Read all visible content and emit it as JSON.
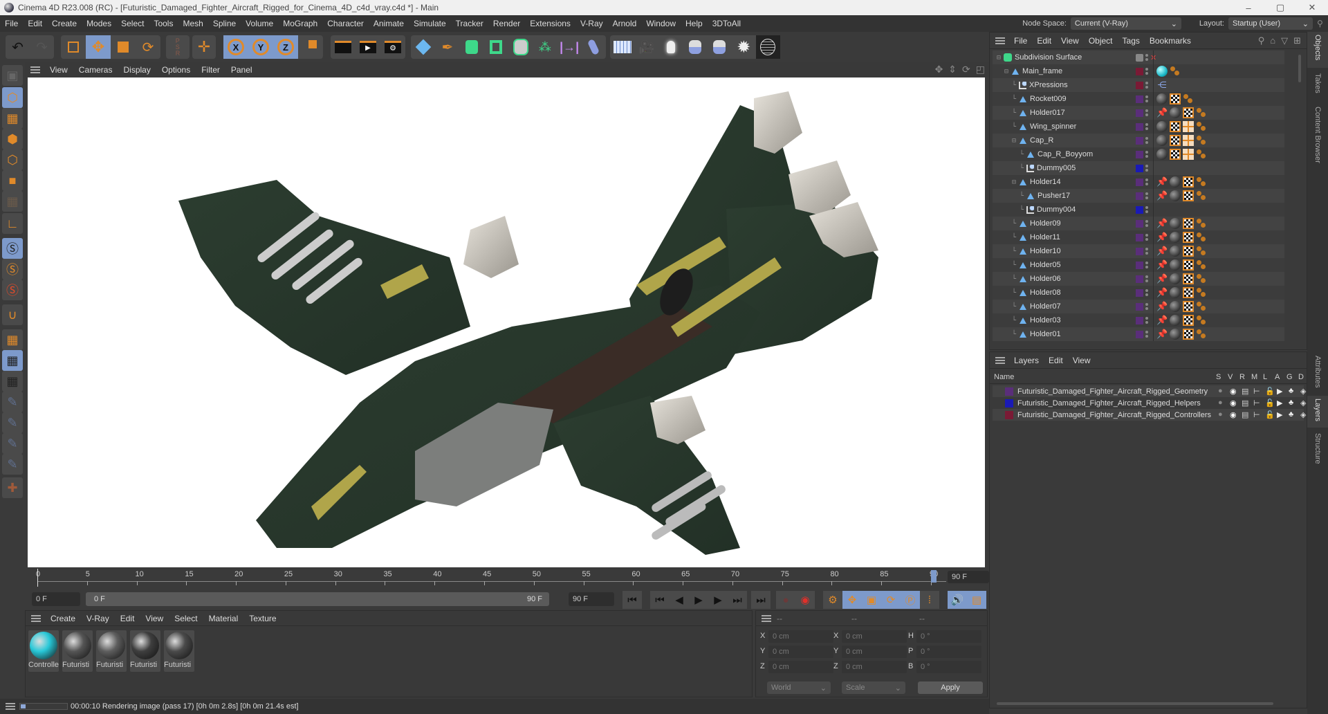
{
  "window": {
    "title": "Cinema 4D R23.008 (RC) - [Futuristic_Damaged_Fighter_Aircraft_Rigged_for_Cinema_4D_c4d_vray.c4d *] - Main",
    "controls": [
      "–",
      "▢",
      "✕"
    ]
  },
  "menubar": {
    "items": [
      "File",
      "Edit",
      "Create",
      "Modes",
      "Select",
      "Tools",
      "Mesh",
      "Spline",
      "Volume",
      "MoGraph",
      "Character",
      "Animate",
      "Simulate",
      "Tracker",
      "Render",
      "Extensions",
      "V-Ray",
      "Arnold",
      "Window",
      "Help",
      "3DToAll"
    ],
    "node_space_label": "Node Space:",
    "node_space_value": "Current (V-Ray)",
    "layout_label": "Layout:",
    "layout_value": "Startup (User)"
  },
  "toolbar": {
    "groups": [
      [
        "undo-icon",
        "redo-icon"
      ],
      [
        "live-selection-icon",
        "move-icon",
        "scale-icon",
        "rotate-icon"
      ],
      [
        "psr-icon"
      ],
      [
        "recent-tool-icon"
      ],
      [
        "x-axis-icon",
        "y-axis-icon",
        "z-axis-icon",
        "coordinate-system-icon"
      ],
      [
        "render-view-icon",
        "render-picture-viewer-icon",
        "render-settings-icon"
      ],
      [
        "cube-icon",
        "pen-icon",
        "subdivision-icon",
        "extrude-icon",
        "cloner-icon",
        "mograph-icon",
        "symmetry-icon",
        "bend-icon"
      ],
      [
        "floor-icon",
        "camera-icon",
        "light-icon",
        "python-icon",
        "python2-icon",
        "gear-shape-icon",
        "sphere-wire-icon"
      ]
    ],
    "active": [
      "move-icon",
      "x-axis-icon",
      "y-axis-icon",
      "z-axis-icon"
    ]
  },
  "lefttools": [
    "make-editable-icon",
    "model-mode-icon",
    "texture-mode-icon",
    "points-mode-icon",
    "edges-mode-icon",
    "polygons-mode-icon",
    "uv-mode-icon",
    "axis-mode-icon",
    "snap-icon",
    "snap-settings-icon",
    "snap-extra-icon",
    "magnet-icon",
    "workplane-icon",
    "locked-workplane-icon",
    "workplane-rotate-icon",
    "pin-icon",
    "pin-p-icon",
    "pin-r-icon",
    "pin-target-icon",
    "paint-icon"
  ],
  "viewport": {
    "menu": [
      "View",
      "Cameras",
      "Display",
      "Options",
      "Filter",
      "Panel"
    ],
    "nav_icons": [
      "move-view-icon",
      "zoom-view-icon",
      "rotate-view-icon",
      "maximize-view-icon"
    ]
  },
  "timeline": {
    "ticks": [
      "0",
      "5",
      "10",
      "15",
      "20",
      "25",
      "30",
      "35",
      "40",
      "45",
      "50",
      "55",
      "60",
      "65",
      "70",
      "75",
      "80",
      "85",
      "90"
    ],
    "current_frame": "0 F",
    "start_field": "0 F",
    "range_start": "0 F",
    "range_end": "90 F",
    "end_field": "90 F",
    "max_field": "90 F",
    "playhead_frame": 0
  },
  "playback": {
    "buttons": [
      "go-to-start-icon",
      "previous-key-icon",
      "previous-frame-icon",
      "play-icon",
      "next-frame-icon",
      "next-key-icon",
      "go-to-end-icon",
      "record-disabled-icon",
      "autokey-icon",
      "keyframe-selection-icon",
      "move-key-icon",
      "scale-key-icon",
      "rotate-key-icon",
      "param-key-icon",
      "pla-key-icon",
      "sound-icon",
      "timeline-icon"
    ]
  },
  "material_manager": {
    "menu": [
      "Create",
      "V-Ray",
      "Edit",
      "View",
      "Select",
      "Material",
      "Texture"
    ],
    "materials": [
      {
        "label": "Controlle",
        "color": "#28c8d8"
      },
      {
        "label": "Futuristi",
        "color": "#555555"
      },
      {
        "label": "Futuristi",
        "color": "#5e5e5e"
      },
      {
        "label": "Futuristi",
        "color": "#3e3e3e"
      },
      {
        "label": "Futuristi",
        "color": "#4a4a4a"
      }
    ]
  },
  "coordinates": {
    "headers": [
      "--",
      "--",
      "--"
    ],
    "rows": [
      {
        "l1": "X",
        "v1": "0 cm",
        "l2": "X",
        "v2": "0 cm",
        "l3": "H",
        "v3": "0 °"
      },
      {
        "l1": "Y",
        "v1": "0 cm",
        "l2": "Y",
        "v2": "0 cm",
        "l3": "P",
        "v3": "0 °"
      },
      {
        "l1": "Z",
        "v1": "0 cm",
        "l2": "Z",
        "v2": "0 cm",
        "l3": "B",
        "v3": "0 °"
      }
    ],
    "mode": "World",
    "transform": "Scale",
    "apply_label": "Apply"
  },
  "status": {
    "text": "00:00:10 Rendering image (pass 17) [0h  0m  2.8s] [0h  0m 21.4s est]",
    "progress": 0.1
  },
  "object_manager": {
    "menu": [
      "File",
      "Edit",
      "View",
      "Object",
      "Tags",
      "Bookmarks"
    ],
    "objects": [
      {
        "name": "Subdivision Surface",
        "depth": 0,
        "type": "subdiv",
        "layer": null,
        "tags": []
      },
      {
        "name": "Main_frame",
        "depth": 1,
        "type": "null",
        "layer": "#7a1a35",
        "tags": [
          "cyan-mat",
          "xp"
        ]
      },
      {
        "name": "XPressions",
        "depth": 2,
        "type": "dummy",
        "layer": "#7a1a35",
        "tags": [
          "xpresso"
        ]
      },
      {
        "name": "Rocket009",
        "depth": 2,
        "type": "null",
        "layer": "#5a2e7a",
        "tags": [
          "mat",
          "tex",
          "xp"
        ]
      },
      {
        "name": "Holder017",
        "depth": 2,
        "type": "null",
        "layer": "#5a2e7a",
        "tags": [
          "ik",
          "mat",
          "tex",
          "xp"
        ]
      },
      {
        "name": "Wing_spinner",
        "depth": 2,
        "type": "null",
        "layer": "#5a2e7a",
        "tags": [
          "mat",
          "tex",
          "uvw",
          "xp"
        ]
      },
      {
        "name": "Cap_R",
        "depth": 2,
        "type": "null",
        "layer": "#5a2e7a",
        "tags": [
          "mat",
          "tex",
          "uvw",
          "xp"
        ]
      },
      {
        "name": "Cap_R_Boyyom",
        "depth": 3,
        "type": "null",
        "layer": "#5a2e7a",
        "tags": [
          "mat",
          "tex",
          "uvw",
          "xp"
        ]
      },
      {
        "name": "Dummy005",
        "depth": 3,
        "type": "dummy",
        "layer": "#1a1ab5",
        "tags": []
      },
      {
        "name": "Holder14",
        "depth": 2,
        "type": "null",
        "layer": "#5a2e7a",
        "tags": [
          "ik",
          "mat",
          "tex",
          "xp"
        ]
      },
      {
        "name": "Pusher17",
        "depth": 3,
        "type": "null",
        "layer": "#5a2e7a",
        "tags": [
          "ik",
          "mat",
          "tex",
          "xp"
        ]
      },
      {
        "name": "Dummy004",
        "depth": 3,
        "type": "dummy",
        "layer": "#1a1ab5",
        "tags": []
      },
      {
        "name": "Holder09",
        "depth": 2,
        "type": "null",
        "layer": "#5a2e7a",
        "tags": [
          "ik",
          "mat",
          "tex",
          "xp"
        ]
      },
      {
        "name": "Holder11",
        "depth": 2,
        "type": "null",
        "layer": "#5a2e7a",
        "tags": [
          "ik",
          "mat",
          "tex",
          "xp"
        ]
      },
      {
        "name": "Holder10",
        "depth": 2,
        "type": "null",
        "layer": "#5a2e7a",
        "tags": [
          "ik",
          "mat",
          "tex",
          "xp"
        ]
      },
      {
        "name": "Holder05",
        "depth": 2,
        "type": "null",
        "layer": "#5a2e7a",
        "tags": [
          "ik",
          "mat",
          "tex",
          "xp"
        ]
      },
      {
        "name": "Holder06",
        "depth": 2,
        "type": "null",
        "layer": "#5a2e7a",
        "tags": [
          "ik",
          "mat",
          "tex",
          "xp"
        ]
      },
      {
        "name": "Holder08",
        "depth": 2,
        "type": "null",
        "layer": "#5a2e7a",
        "tags": [
          "ik",
          "mat",
          "tex",
          "xp"
        ]
      },
      {
        "name": "Holder07",
        "depth": 2,
        "type": "null",
        "layer": "#5a2e7a",
        "tags": [
          "ik",
          "mat",
          "tex",
          "xp"
        ]
      },
      {
        "name": "Holder03",
        "depth": 2,
        "type": "null",
        "layer": "#5a2e7a",
        "tags": [
          "ik",
          "mat",
          "tex",
          "xp"
        ]
      },
      {
        "name": "Holder01",
        "depth": 2,
        "type": "null",
        "layer": "#5a2e7a",
        "tags": [
          "ik",
          "mat",
          "tex",
          "xp"
        ]
      }
    ]
  },
  "layer_manager": {
    "menu": [
      "Layers",
      "Edit",
      "View"
    ],
    "name_header": "Name",
    "columns": [
      "S",
      "V",
      "R",
      "M",
      "L",
      "A",
      "G",
      "D"
    ],
    "layers": [
      {
        "name": "Futuristic_Damaged_Fighter_Aircraft_Rigged_Geometry",
        "color": "#5a2e7a"
      },
      {
        "name": "Futuristic_Damaged_Fighter_Aircraft_Rigged_Helpers",
        "color": "#1a1ab5"
      },
      {
        "name": "Futuristic_Damaged_Fighter_Aircraft_Rigged_Controllers",
        "color": "#7a1a35"
      }
    ]
  },
  "side_tabs": {
    "top": [
      "Objects",
      "Takes",
      "Content Browser"
    ],
    "bottom": [
      "Attributes",
      "Layers",
      "Structure"
    ]
  },
  "colors": {
    "accent_active": "#7d9acb",
    "orange": "#e08a2a",
    "panel": "#3a3a3a"
  }
}
